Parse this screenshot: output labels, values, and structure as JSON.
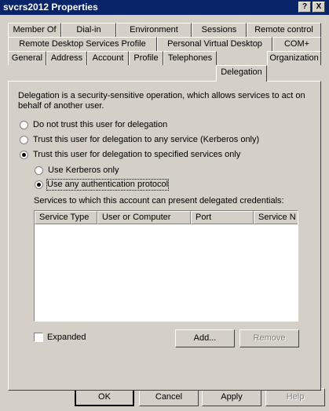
{
  "window": {
    "title": "svcrs2012 Properties",
    "help_glyph": "?",
    "close_glyph": "X"
  },
  "tabs": {
    "row1": [
      "Member Of",
      "Dial-in",
      "Environment",
      "Sessions",
      "Remote control"
    ],
    "row2": [
      "Remote Desktop Services Profile",
      "Personal Virtual Desktop",
      "COM+"
    ],
    "row3": [
      "General",
      "Address",
      "Account",
      "Profile",
      "Telephones",
      "Delegation",
      "Organization"
    ],
    "active": "Delegation"
  },
  "delegation": {
    "description_line1": "Delegation is a security-sensitive operation, which allows services to act on",
    "description_line2": "behalf of another user.",
    "options": [
      {
        "label": "Do not trust this user for delegation",
        "selected": false
      },
      {
        "label": "Trust this user for delegation to any service (Kerberos only)",
        "selected": false
      },
      {
        "label": "Trust this user for delegation to specified services only",
        "selected": true
      }
    ],
    "sub_options": [
      {
        "label": "Use Kerberos only",
        "selected": false
      },
      {
        "label": "Use any authentication protocol",
        "selected": true
      }
    ],
    "services_label": "Services to which this account can present delegated credentials:",
    "columns": [
      "Service Type",
      "User or Computer",
      "Port",
      "Service N"
    ],
    "expanded_label": "Expanded",
    "expanded_checked": false,
    "add_label": "Add...",
    "remove_label": "Remove"
  },
  "footer": {
    "ok_label": "OK",
    "cancel_label": "Cancel",
    "apply_label": "Apply",
    "help_label": "Help"
  }
}
